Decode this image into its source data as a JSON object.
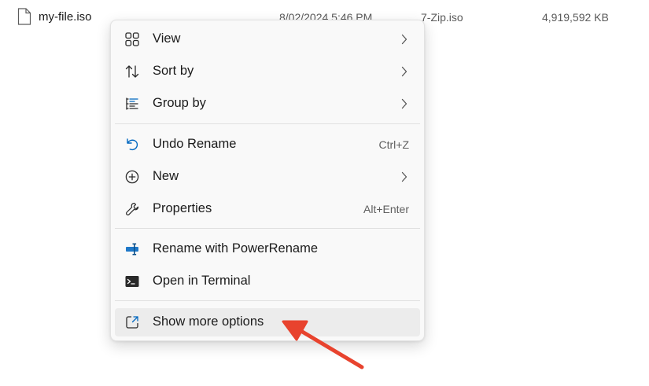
{
  "file": {
    "name": "my-file.iso",
    "date": "8/02/2024 5:46 PM",
    "type": "7-Zip.iso",
    "size": "4,919,592 KB"
  },
  "menu": {
    "items": [
      {
        "label": "View",
        "icon": "grid-icon",
        "submenu": true
      },
      {
        "label": "Sort by",
        "icon": "sort-icon",
        "submenu": true
      },
      {
        "label": "Group by",
        "icon": "group-list-icon",
        "submenu": true
      },
      {
        "label": "Undo Rename",
        "icon": "undo-icon",
        "shortcut": "Ctrl+Z"
      },
      {
        "label": "New",
        "icon": "plus-circle-icon",
        "submenu": true
      },
      {
        "label": "Properties",
        "icon": "wrench-icon",
        "shortcut": "Alt+Enter"
      },
      {
        "label": "Rename with PowerRename",
        "icon": "powerrename-icon"
      },
      {
        "label": "Open in Terminal",
        "icon": "terminal-icon"
      },
      {
        "label": "Show more options",
        "icon": "external-open-icon"
      }
    ]
  },
  "colors": {
    "accent": "#0067c0",
    "annotation_arrow": "#e8432e"
  }
}
